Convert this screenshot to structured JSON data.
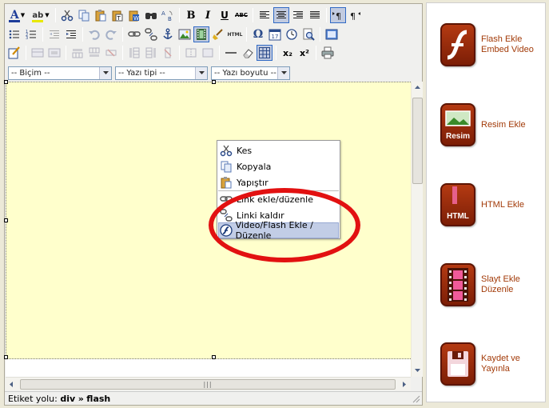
{
  "toolbar": {
    "bold_glyph": "B",
    "italic_glyph": "I",
    "underline_glyph": "U",
    "strike_glyph": "ABC",
    "html_glyph": "HTML",
    "omega_glyph": "Ω",
    "calendar_glyph": "17",
    "sub_glyph": "x₂",
    "sup_glyph": "x²",
    "text_color_glyph": "A",
    "highlight_glyph": "ab"
  },
  "selects": {
    "format": "-- Biçim --",
    "font": "-- Yazı tipi --",
    "size": "-- Yazı boyutu --"
  },
  "context_menu": {
    "items": [
      {
        "label": "Kes",
        "icon": "scissors-icon"
      },
      {
        "label": "Kopyala",
        "icon": "copy-icon"
      },
      {
        "label": "Yapıştır",
        "icon": "paste-icon"
      },
      {
        "label": "Link ekle/düzenle",
        "icon": "link-icon"
      },
      {
        "label": "Linki kaldır",
        "icon": "unlink-icon"
      },
      {
        "label": "Video/Flash Ekle / Düzenle",
        "icon": "flash-icon"
      }
    ]
  },
  "statusbar": {
    "label": "Etiket yolu:",
    "path_1": "div",
    "separator": "»",
    "path_2": "flash"
  },
  "panel": {
    "items": [
      {
        "label": "Flash Ekle Embed Video",
        "icon": "flash-icon"
      },
      {
        "label": "Resim Ekle",
        "icon": "image-icon",
        "icon_text": "Resim"
      },
      {
        "label": "HTML Ekle",
        "icon": "html-book-icon",
        "icon_text": "HTML"
      },
      {
        "label": "Slayt Ekle Düzenle",
        "icon": "film-strip-icon"
      },
      {
        "label": "Kaydet ve Yayınla",
        "icon": "floppy-disk-icon"
      }
    ]
  },
  "colors": {
    "content_bg": "#ffffcc",
    "accent_red": "#e21111",
    "panel_label": "#a23a08",
    "menu_highlight": "#c2cde6"
  }
}
